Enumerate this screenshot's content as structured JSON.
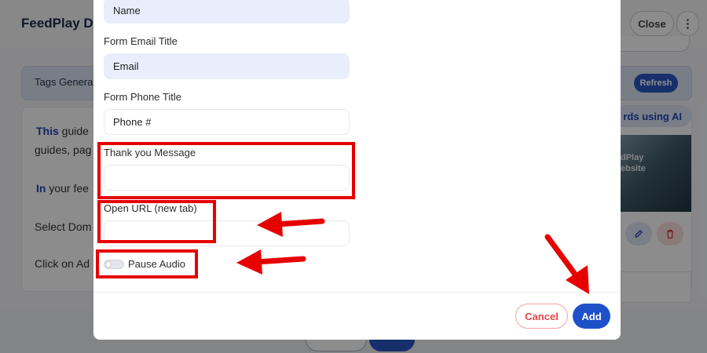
{
  "background": {
    "app_title": "FeedPlay D",
    "close_label": "Close",
    "more_icon": "⋮",
    "tags_label": "Tags Genera",
    "refresh_label": "Refresh",
    "ai_button_label": "rds using AI",
    "guide_lines": [
      {
        "bold": "This",
        "text": " guide"
      },
      {
        "bold": "",
        "text": "guides, pag"
      },
      {
        "bold": "In",
        "text": " your fee"
      },
      {
        "bold": "",
        "text": "Select Dom"
      },
      {
        "bold": "",
        "text": "Click on Ad"
      }
    ],
    "thumbnail_text": "dPlay\nebsite"
  },
  "modal": {
    "fields": [
      {
        "label": "",
        "value": "Name"
      },
      {
        "label": "Form Email Title",
        "value": "Email"
      },
      {
        "label": "Form Phone Title",
        "value": "Phone #"
      },
      {
        "label": "Thank you Message",
        "value": ""
      },
      {
        "label": "Open URL (new tab)",
        "value": ""
      }
    ],
    "pause_audio_label": "Pause Audio",
    "pause_audio_on": false,
    "cancel_label": "Cancel",
    "add_label": "Add"
  },
  "annotation_color": "#e60000"
}
